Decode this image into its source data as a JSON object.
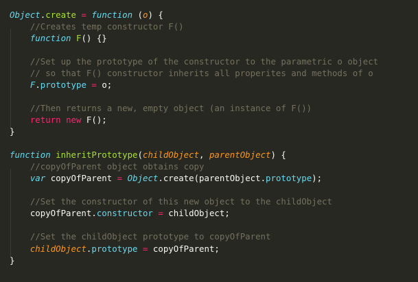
{
  "editor": {
    "colors": {
      "background": "#272822",
      "plain": "#f8f8f2",
      "keyword": "#f92672",
      "storage": "#66d9ef",
      "function_name": "#a6e22e",
      "parameter": "#fd971f",
      "comment": "#75715e"
    },
    "lines": [
      [
        [
          "builtin",
          "Object"
        ],
        [
          "plain",
          "."
        ],
        [
          "fn",
          "create"
        ],
        [
          "plain",
          " "
        ],
        [
          "op",
          "="
        ],
        [
          "plain",
          " "
        ],
        [
          "storage",
          "function"
        ],
        [
          "plain",
          " ("
        ],
        [
          "param",
          "o"
        ],
        [
          "plain",
          ") {"
        ]
      ],
      [
        [
          "plain",
          "    "
        ],
        [
          "comment",
          "//Creates temp constructor F()"
        ]
      ],
      [
        [
          "plain",
          "    "
        ],
        [
          "storage",
          "function"
        ],
        [
          "plain",
          " "
        ],
        [
          "fn",
          "F"
        ],
        [
          "plain",
          "() {}"
        ]
      ],
      [],
      [
        [
          "plain",
          "    "
        ],
        [
          "comment",
          "//Set up the prototype of the constructor to the parametric o object"
        ]
      ],
      [
        [
          "plain",
          "    "
        ],
        [
          "comment",
          "// so that F() constructor inherits all properites and methods of o"
        ]
      ],
      [
        [
          "plain",
          "    "
        ],
        [
          "builtin",
          "F"
        ],
        [
          "plain",
          "."
        ],
        [
          "prop",
          "prototype"
        ],
        [
          "plain",
          " "
        ],
        [
          "op",
          "="
        ],
        [
          "plain",
          " o;"
        ]
      ],
      [],
      [
        [
          "plain",
          "    "
        ],
        [
          "comment",
          "//Then returns a new, empty object (an instance of F())"
        ]
      ],
      [
        [
          "plain",
          "    "
        ],
        [
          "keyword",
          "return"
        ],
        [
          "plain",
          " "
        ],
        [
          "keyword",
          "new"
        ],
        [
          "plain",
          " F();"
        ]
      ],
      [
        [
          "plain",
          "}"
        ]
      ],
      [],
      [
        [
          "storage",
          "function"
        ],
        [
          "plain",
          " "
        ],
        [
          "fn",
          "inheritPrototype"
        ],
        [
          "plain",
          "("
        ],
        [
          "param",
          "childObject"
        ],
        [
          "plain",
          ", "
        ],
        [
          "param",
          "parentObject"
        ],
        [
          "plain",
          ") {"
        ]
      ],
      [
        [
          "plain",
          "    "
        ],
        [
          "comment",
          "//copyOfParent object obtains copy"
        ]
      ],
      [
        [
          "plain",
          "    "
        ],
        [
          "storage",
          "var"
        ],
        [
          "plain",
          " copyOfParent "
        ],
        [
          "op",
          "="
        ],
        [
          "plain",
          " "
        ],
        [
          "builtin",
          "Object"
        ],
        [
          "plain",
          ".create(parentObject."
        ],
        [
          "prop",
          "prototype"
        ],
        [
          "plain",
          ");"
        ]
      ],
      [],
      [
        [
          "plain",
          "    "
        ],
        [
          "comment",
          "//Set the constructor of this new object to the childObject"
        ]
      ],
      [
        [
          "plain",
          "    copyOfParent."
        ],
        [
          "prop",
          "constructor"
        ],
        [
          "plain",
          " "
        ],
        [
          "op",
          "="
        ],
        [
          "plain",
          " childObject;"
        ]
      ],
      [],
      [
        [
          "plain",
          "    "
        ],
        [
          "comment",
          "//Set the childObject prototype to copyOfParent"
        ]
      ],
      [
        [
          "plain",
          "    "
        ],
        [
          "param",
          "childObject"
        ],
        [
          "plain",
          "."
        ],
        [
          "prop",
          "prototype"
        ],
        [
          "plain",
          " "
        ],
        [
          "op",
          "="
        ],
        [
          "plain",
          " copyOfParent;"
        ]
      ],
      [
        [
          "plain",
          "}"
        ]
      ]
    ]
  }
}
